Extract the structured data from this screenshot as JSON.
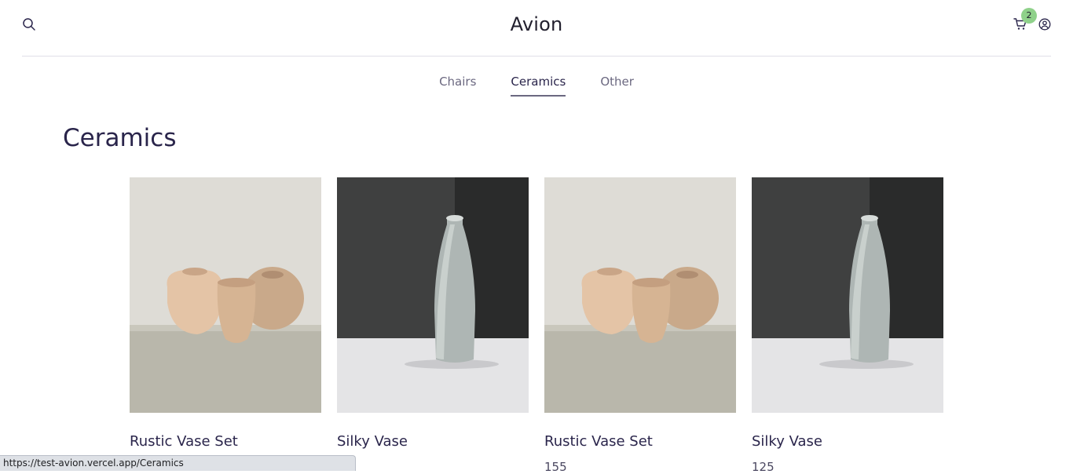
{
  "header": {
    "logo": "Avion",
    "cart_count": "2",
    "icons": {
      "search": "search-icon",
      "cart": "cart-icon",
      "user": "user-icon"
    },
    "badge_color": "#8fd18a"
  },
  "nav": {
    "items": [
      {
        "label": "Chairs",
        "active": false
      },
      {
        "label": "Ceramics",
        "active": true
      },
      {
        "label": "Other",
        "active": false
      }
    ]
  },
  "page": {
    "title": "Ceramics"
  },
  "products": [
    {
      "name": "Rustic Vase Set",
      "price": "",
      "image": "rustic-vases"
    },
    {
      "name": "Silky Vase",
      "price": "",
      "image": "silky-vase"
    },
    {
      "name": "Rustic Vase Set",
      "price": "155",
      "image": "rustic-vases"
    },
    {
      "name": "Silky Vase",
      "price": "125",
      "image": "silky-vase"
    }
  ],
  "status_bar": {
    "url": "https://test-avion.vercel.app/Ceramics"
  },
  "colors": {
    "text_primary": "#2a254b",
    "text_muted": "#6b6880"
  }
}
